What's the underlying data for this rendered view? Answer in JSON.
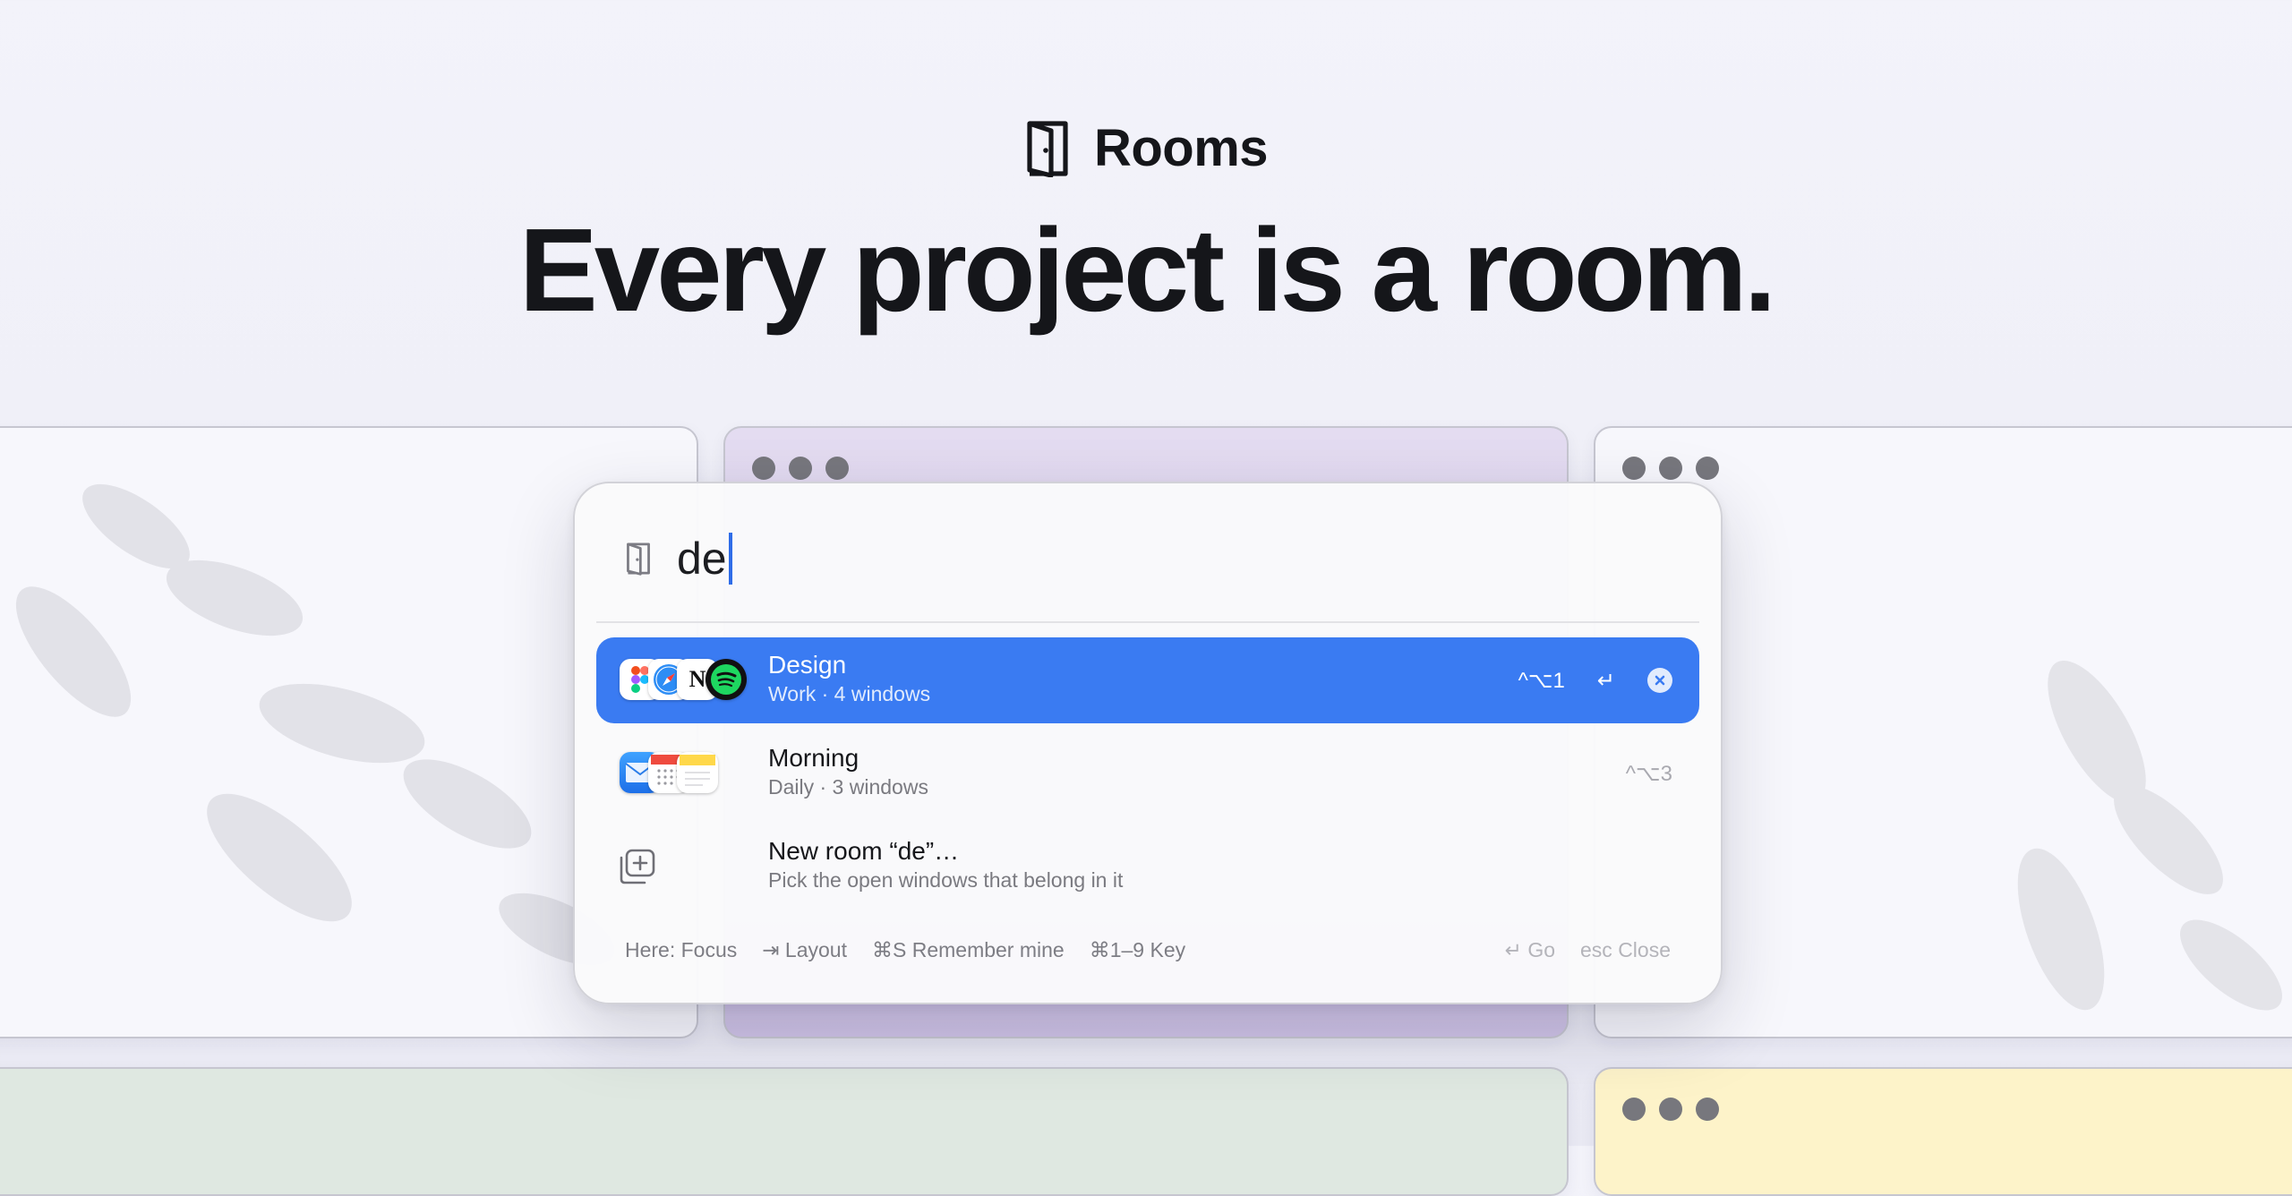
{
  "brand": {
    "name": "Rooms",
    "icon": "door-icon"
  },
  "headline": "Every project is a room.",
  "colors": {
    "accent": "#3a7bf2",
    "text": "#15161a",
    "purple_window": "#ddd3ee",
    "green_window": "#dfe8e1",
    "yellow_window": "#fdf3c9"
  },
  "palette": {
    "search": {
      "icon": "door-icon",
      "value": "de"
    },
    "results": [
      {
        "title": "Design",
        "subtitle": "Work · 4 windows",
        "shortcut": "^⌥1",
        "enter": "↵",
        "selected": true,
        "apps": [
          "figma-icon",
          "safari-icon",
          "notion-icon",
          "spotify-icon"
        ]
      },
      {
        "title": "Morning",
        "subtitle": "Daily · 3 windows",
        "shortcut": "^⌥3",
        "selected": false,
        "apps": [
          "mail-icon",
          "calendar-icon",
          "notes-icon"
        ]
      },
      {
        "title": "New room “de”…",
        "subtitle": "Pick the open windows that belong in it",
        "icon": "add-window-icon"
      }
    ],
    "footer": {
      "hints_left": [
        "Here: Focus",
        "⇥ Layout",
        "⌘S Remember mine",
        "⌘1–9 Key"
      ],
      "hints_right": [
        "↵ Go",
        "esc Close"
      ]
    }
  },
  "apps": {
    "notion_glyph": "N"
  }
}
